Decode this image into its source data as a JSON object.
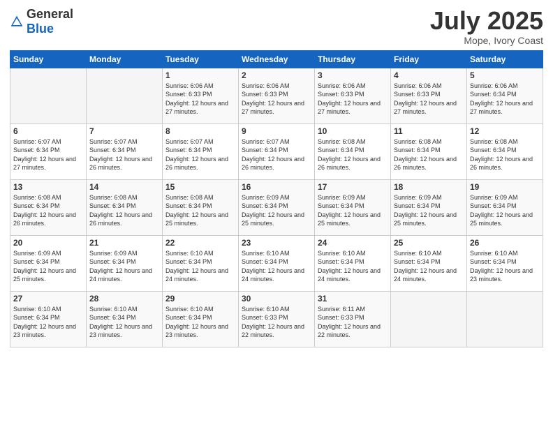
{
  "header": {
    "logo_general": "General",
    "logo_blue": "Blue",
    "month_title": "July 2025",
    "location": "Mope, Ivory Coast"
  },
  "days_of_week": [
    "Sunday",
    "Monday",
    "Tuesday",
    "Wednesday",
    "Thursday",
    "Friday",
    "Saturday"
  ],
  "weeks": [
    [
      {
        "day": "",
        "info": ""
      },
      {
        "day": "",
        "info": ""
      },
      {
        "day": "1",
        "info": "Sunrise: 6:06 AM\nSunset: 6:33 PM\nDaylight: 12 hours and 27 minutes."
      },
      {
        "day": "2",
        "info": "Sunrise: 6:06 AM\nSunset: 6:33 PM\nDaylight: 12 hours and 27 minutes."
      },
      {
        "day": "3",
        "info": "Sunrise: 6:06 AM\nSunset: 6:33 PM\nDaylight: 12 hours and 27 minutes."
      },
      {
        "day": "4",
        "info": "Sunrise: 6:06 AM\nSunset: 6:33 PM\nDaylight: 12 hours and 27 minutes."
      },
      {
        "day": "5",
        "info": "Sunrise: 6:06 AM\nSunset: 6:34 PM\nDaylight: 12 hours and 27 minutes."
      }
    ],
    [
      {
        "day": "6",
        "info": "Sunrise: 6:07 AM\nSunset: 6:34 PM\nDaylight: 12 hours and 27 minutes."
      },
      {
        "day": "7",
        "info": "Sunrise: 6:07 AM\nSunset: 6:34 PM\nDaylight: 12 hours and 26 minutes."
      },
      {
        "day": "8",
        "info": "Sunrise: 6:07 AM\nSunset: 6:34 PM\nDaylight: 12 hours and 26 minutes."
      },
      {
        "day": "9",
        "info": "Sunrise: 6:07 AM\nSunset: 6:34 PM\nDaylight: 12 hours and 26 minutes."
      },
      {
        "day": "10",
        "info": "Sunrise: 6:08 AM\nSunset: 6:34 PM\nDaylight: 12 hours and 26 minutes."
      },
      {
        "day": "11",
        "info": "Sunrise: 6:08 AM\nSunset: 6:34 PM\nDaylight: 12 hours and 26 minutes."
      },
      {
        "day": "12",
        "info": "Sunrise: 6:08 AM\nSunset: 6:34 PM\nDaylight: 12 hours and 26 minutes."
      }
    ],
    [
      {
        "day": "13",
        "info": "Sunrise: 6:08 AM\nSunset: 6:34 PM\nDaylight: 12 hours and 26 minutes."
      },
      {
        "day": "14",
        "info": "Sunrise: 6:08 AM\nSunset: 6:34 PM\nDaylight: 12 hours and 26 minutes."
      },
      {
        "day": "15",
        "info": "Sunrise: 6:08 AM\nSunset: 6:34 PM\nDaylight: 12 hours and 25 minutes."
      },
      {
        "day": "16",
        "info": "Sunrise: 6:09 AM\nSunset: 6:34 PM\nDaylight: 12 hours and 25 minutes."
      },
      {
        "day": "17",
        "info": "Sunrise: 6:09 AM\nSunset: 6:34 PM\nDaylight: 12 hours and 25 minutes."
      },
      {
        "day": "18",
        "info": "Sunrise: 6:09 AM\nSunset: 6:34 PM\nDaylight: 12 hours and 25 minutes."
      },
      {
        "day": "19",
        "info": "Sunrise: 6:09 AM\nSunset: 6:34 PM\nDaylight: 12 hours and 25 minutes."
      }
    ],
    [
      {
        "day": "20",
        "info": "Sunrise: 6:09 AM\nSunset: 6:34 PM\nDaylight: 12 hours and 25 minutes."
      },
      {
        "day": "21",
        "info": "Sunrise: 6:09 AM\nSunset: 6:34 PM\nDaylight: 12 hours and 24 minutes."
      },
      {
        "day": "22",
        "info": "Sunrise: 6:10 AM\nSunset: 6:34 PM\nDaylight: 12 hours and 24 minutes."
      },
      {
        "day": "23",
        "info": "Sunrise: 6:10 AM\nSunset: 6:34 PM\nDaylight: 12 hours and 24 minutes."
      },
      {
        "day": "24",
        "info": "Sunrise: 6:10 AM\nSunset: 6:34 PM\nDaylight: 12 hours and 24 minutes."
      },
      {
        "day": "25",
        "info": "Sunrise: 6:10 AM\nSunset: 6:34 PM\nDaylight: 12 hours and 24 minutes."
      },
      {
        "day": "26",
        "info": "Sunrise: 6:10 AM\nSunset: 6:34 PM\nDaylight: 12 hours and 23 minutes."
      }
    ],
    [
      {
        "day": "27",
        "info": "Sunrise: 6:10 AM\nSunset: 6:34 PM\nDaylight: 12 hours and 23 minutes."
      },
      {
        "day": "28",
        "info": "Sunrise: 6:10 AM\nSunset: 6:34 PM\nDaylight: 12 hours and 23 minutes."
      },
      {
        "day": "29",
        "info": "Sunrise: 6:10 AM\nSunset: 6:34 PM\nDaylight: 12 hours and 23 minutes."
      },
      {
        "day": "30",
        "info": "Sunrise: 6:10 AM\nSunset: 6:33 PM\nDaylight: 12 hours and 22 minutes."
      },
      {
        "day": "31",
        "info": "Sunrise: 6:11 AM\nSunset: 6:33 PM\nDaylight: 12 hours and 22 minutes."
      },
      {
        "day": "",
        "info": ""
      },
      {
        "day": "",
        "info": ""
      }
    ]
  ]
}
